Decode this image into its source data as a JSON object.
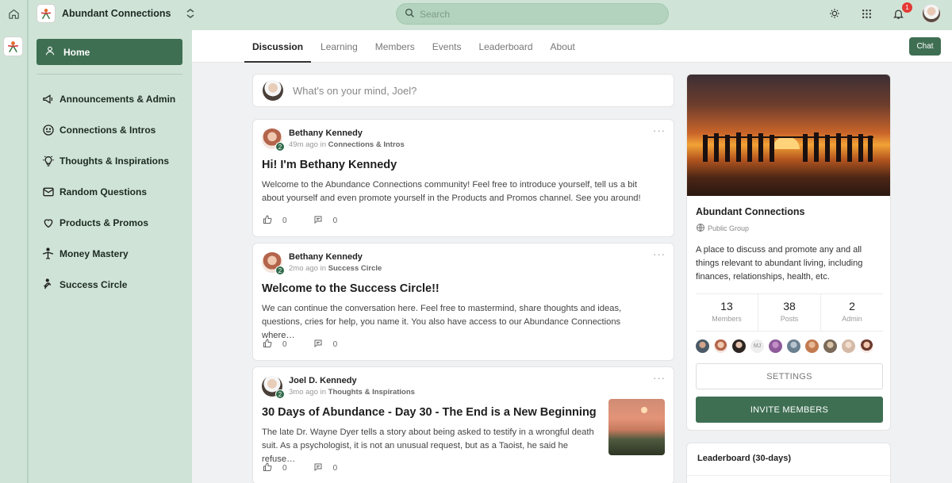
{
  "app": {
    "name": "Abundant Connections"
  },
  "search": {
    "placeholder": "Search"
  },
  "notifications": {
    "count": "1"
  },
  "sidebar": {
    "home": "Home",
    "items": [
      {
        "label": "Announcements & Admin",
        "icon": "megaphone-icon"
      },
      {
        "label": "Connections & Intros",
        "icon": "smiley-icon"
      },
      {
        "label": "Thoughts & Inspirations",
        "icon": "lightbulb-icon"
      },
      {
        "label": "Random Questions",
        "icon": "envelope-icon"
      },
      {
        "label": "Products & Promos",
        "icon": "heart-icon"
      },
      {
        "label": "Money Mastery",
        "icon": "money-mastery-icon"
      },
      {
        "label": "Success Circle",
        "icon": "success-circle-icon"
      }
    ]
  },
  "tabs": [
    "Discussion",
    "Learning",
    "Members",
    "Events",
    "Leaderboard",
    "About"
  ],
  "chat_label": "Chat",
  "composer": {
    "placeholder": "What's on your mind, Joel?"
  },
  "posts": [
    {
      "author": "Bethany Kennedy",
      "level": "2",
      "time": "49m ago",
      "in": "in",
      "channel": "Connections & Intros",
      "title": "Hi! I'm Bethany Kennedy",
      "body": "Welcome to the Abundance Connections community! Feel free to introduce yourself, tell us a bit about yourself and even promote yourself in the Products and Promos channel. See you around!",
      "likes": "0",
      "comments": "0"
    },
    {
      "author": "Bethany Kennedy",
      "level": "2",
      "time": "2mo ago",
      "in": "in",
      "channel": "Success Circle",
      "title": "Welcome to the Success Circle!!",
      "body": "We can continue the conversation here. Feel free to mastermind, share thoughts and ideas, questions, cries for help, you name it. You also have access to our Abundance Connections where…",
      "likes": "0",
      "comments": "0"
    },
    {
      "author": "Joel D. Kennedy",
      "level": "2",
      "time": "3mo ago",
      "in": "in",
      "channel": "Thoughts & Inspirations",
      "title": "30 Days of Abundance - Day 30 - The End is a New Beginning",
      "body": "The late Dr. Wayne Dyer tells a story about being asked to testify in a wrongful death suit. As a psychologist, it is not an unusual request, but as a Taoist, he said he refuse…",
      "likes": "0",
      "comments": "0"
    }
  ],
  "group": {
    "name": "Abundant Connections",
    "type": "Public Group",
    "description": "A place to discuss and promote any and all things relevant to abundant living, including finances, relationships, health, etc.",
    "stats": [
      {
        "value": "13",
        "label": "Members"
      },
      {
        "value": "38",
        "label": "Posts"
      },
      {
        "value": "2",
        "label": "Admin"
      }
    ],
    "member_initials": "MJ",
    "settings_label": "SETTINGS",
    "invite_label": "INVITE MEMBERS"
  },
  "leaderboard": {
    "title": "Leaderboard (30-days)"
  },
  "colors": {
    "brand_green": "#3f6f53",
    "chrome_green": "#cfe4d6",
    "badge_red": "#e53935"
  }
}
